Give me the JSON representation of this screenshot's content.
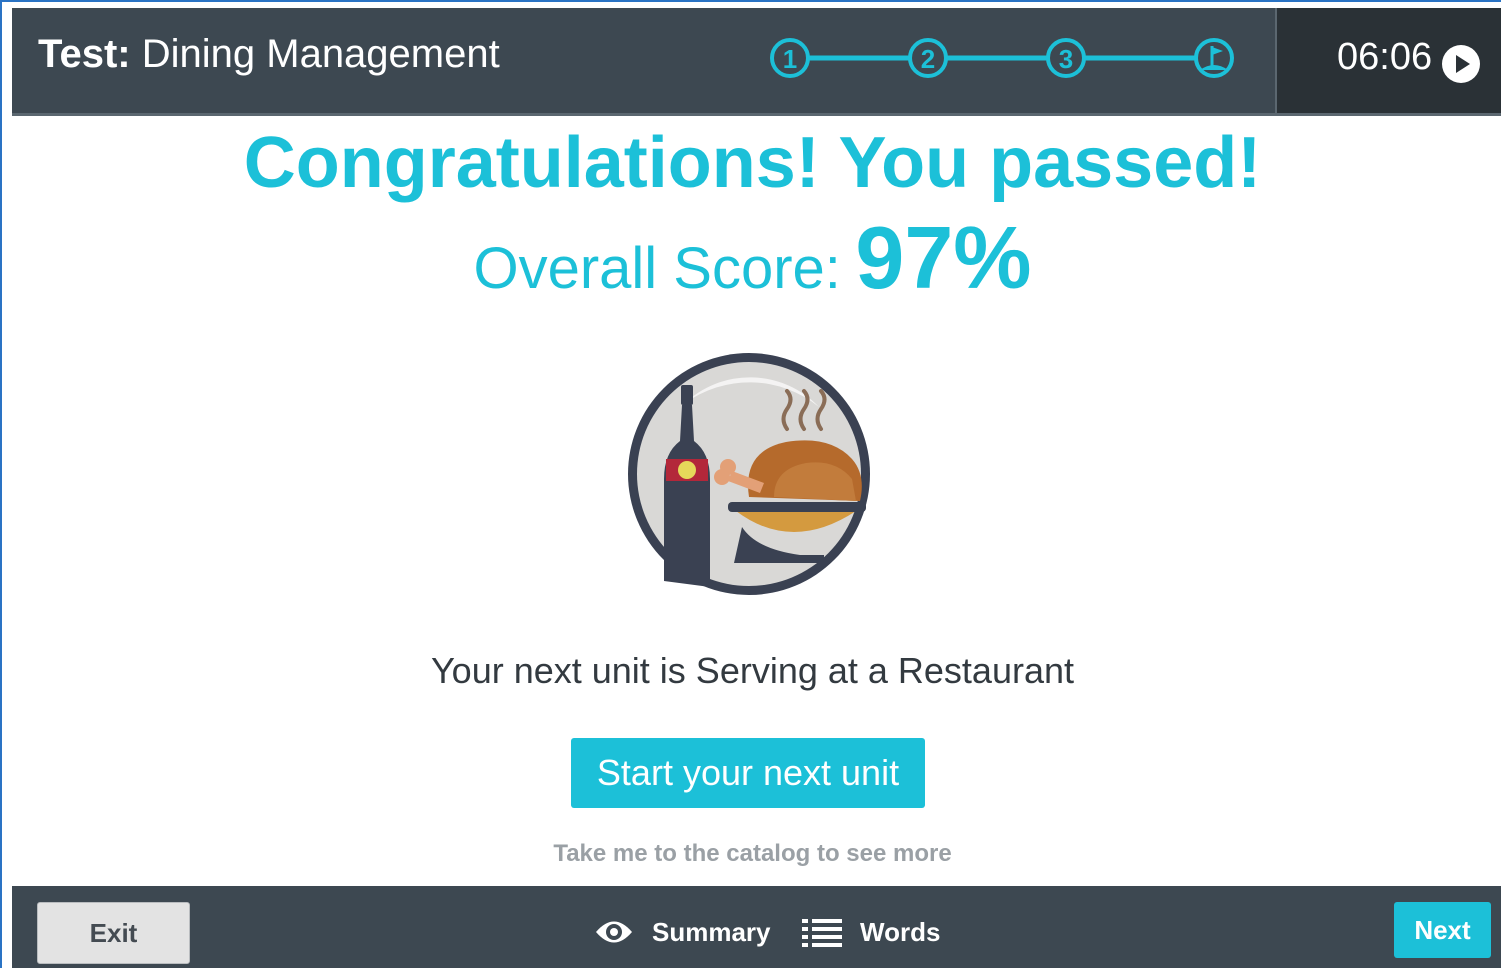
{
  "header": {
    "title_prefix": "Test:",
    "title_name": "Dining Management",
    "steps": [
      "1",
      "2",
      "3"
    ],
    "final_step_icon": "flag-icon",
    "timer": "06:06",
    "timer_icon": "play-icon"
  },
  "main": {
    "congrats": "Congratulations! You passed!",
    "score_label": "Overall Score:",
    "score_value": "97%",
    "illustration_icon": "dining-icon",
    "next_unit_text": "Your next unit is Serving at a Restaurant",
    "start_button": "Start your next unit",
    "catalog_link": "Take me to the catalog to see more"
  },
  "footer": {
    "exit": "Exit",
    "summary": "Summary",
    "summary_icon": "eye-icon",
    "words": "Words",
    "words_icon": "list-icon",
    "next": "Next"
  },
  "colors": {
    "accent": "#1cc0d8",
    "header_bg": "#3d4851",
    "timer_bg": "#2a3136",
    "text_dark": "#333a40",
    "muted": "#9aa0a5"
  }
}
